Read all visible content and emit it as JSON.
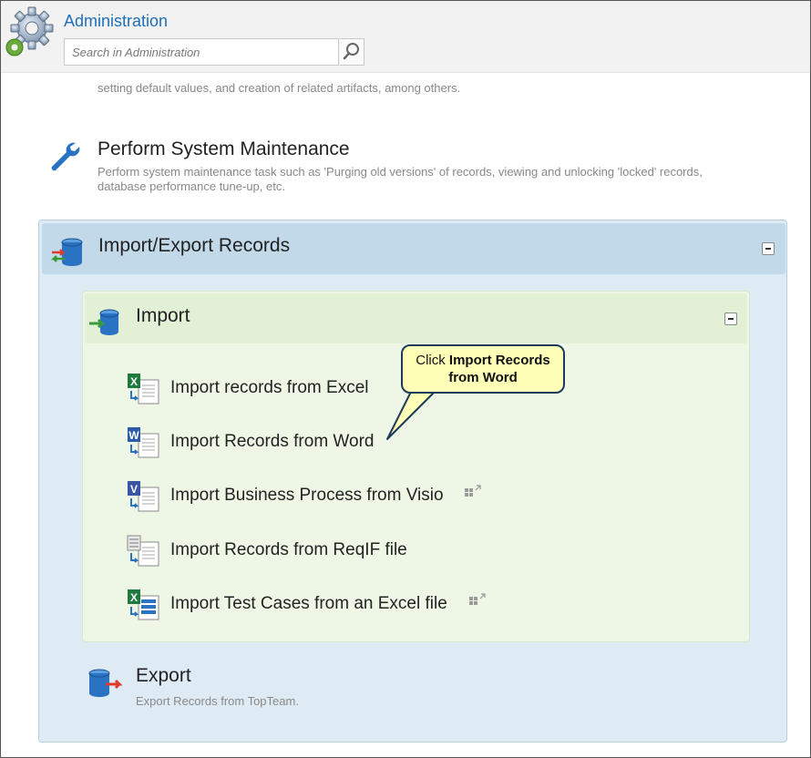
{
  "header": {
    "title": "Administration",
    "search_placeholder": "Search in Administration"
  },
  "cut_off_text": "setting default values, and creation of related artifacts, among others.",
  "maintenance": {
    "title": "Perform System Maintenance",
    "description": "Perform system maintenance task such as 'Purging old versions' of records, viewing and unlocking 'locked' records, database performance tune-up, etc."
  },
  "import_export": {
    "title": "Import/Export Records",
    "import": {
      "title": "Import",
      "items": [
        {
          "label": "Import records from Excel",
          "icon": "excel-import-icon"
        },
        {
          "label": "Import Records from Word",
          "icon": "word-import-icon"
        },
        {
          "label": "Import Business Process from Visio",
          "icon": "visio-import-icon",
          "popout": true
        },
        {
          "label": "Import Records from ReqIF file",
          "icon": "reqif-import-icon"
        },
        {
          "label": "Import Test Cases from an Excel file",
          "icon": "excel-testcase-import-icon",
          "popout": true
        }
      ]
    },
    "export": {
      "title": "Export",
      "description": "Export Records from TopTeam."
    }
  },
  "callout": {
    "prefix": "Click ",
    "bold": "Import Records from Word"
  },
  "colors": {
    "title_blue": "#1f6fb8",
    "ie_panel_bg": "#dfebf4",
    "ie_header_bg": "#c2d9ea",
    "import_panel_bg": "#eef7e6",
    "import_header_bg": "#e2f0d6",
    "callout_bg": "#ffffb8",
    "callout_border": "#1e3a5a"
  }
}
